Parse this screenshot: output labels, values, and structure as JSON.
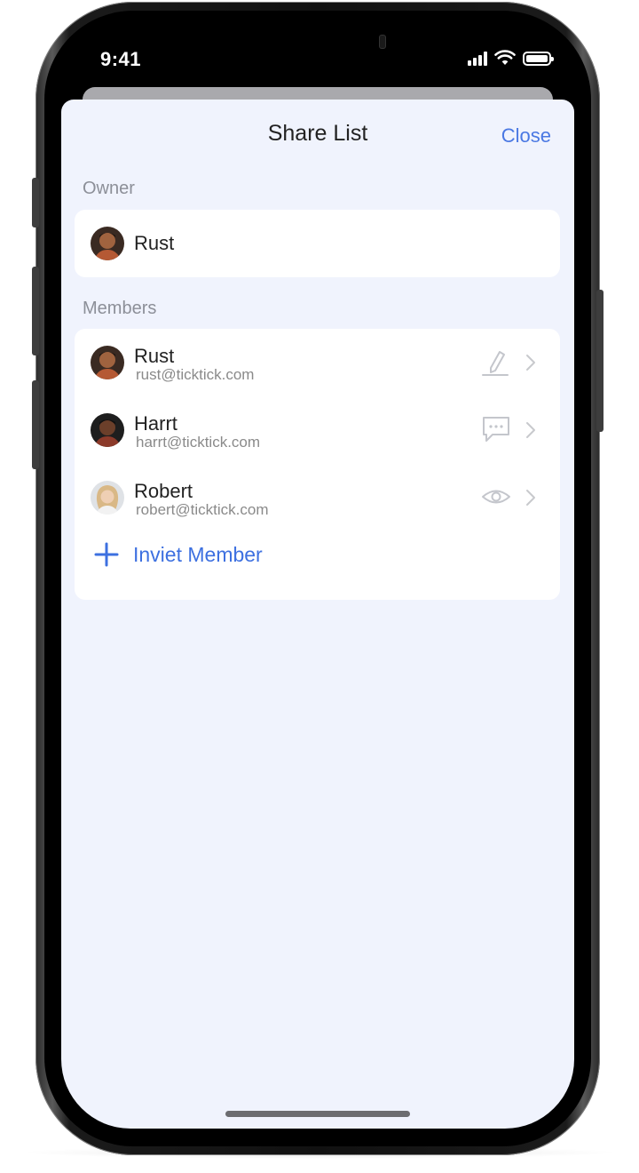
{
  "status_bar": {
    "time": "9:41"
  },
  "sheet": {
    "title": "Share List",
    "close_label": "Close"
  },
  "owner_section": {
    "label": "Owner",
    "owner": {
      "name": "Rust"
    }
  },
  "members_section": {
    "label": "Members",
    "members": [
      {
        "name": "Rust",
        "email": "rust@ticktick.com",
        "role_icon": "pencil-icon"
      },
      {
        "name": "Harrt",
        "email": "harrt@ticktick.com",
        "role_icon": "comment-icon"
      },
      {
        "name": "Robert",
        "email": "robert@ticktick.com",
        "role_icon": "eye-icon"
      }
    ],
    "invite_label": "Inviet Member"
  },
  "colors": {
    "accent": "#4a78e3",
    "sheet_background": "#f0f3fd",
    "card_background": "#ffffff",
    "secondary_text": "#8c8f98"
  }
}
